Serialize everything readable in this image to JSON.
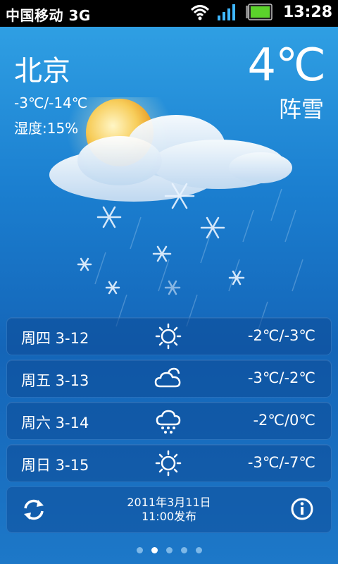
{
  "status_bar": {
    "carrier": "中国移动 3G",
    "time": "13:28"
  },
  "current": {
    "city": "北京",
    "range": "-3℃/-14℃",
    "humidity": "湿度:15%",
    "temperature": "4℃",
    "condition": "阵雪"
  },
  "forecast": [
    {
      "day": "周四 3-12",
      "icon": "sunny-icon",
      "temp": "-2℃/-3℃"
    },
    {
      "day": "周五 3-13",
      "icon": "cloudy-icon",
      "temp": "-3℃/-2℃"
    },
    {
      "day": "周六 3-14",
      "icon": "snow-cloud-icon",
      "temp": "-2℃/0℃"
    },
    {
      "day": "周日 3-15",
      "icon": "sunny-icon",
      "temp": "-3℃/-7℃"
    }
  ],
  "footer": {
    "publish_date": "2011年3月11日",
    "publish_time": "11:00发布"
  },
  "pager": {
    "count": 5,
    "active": 2
  }
}
